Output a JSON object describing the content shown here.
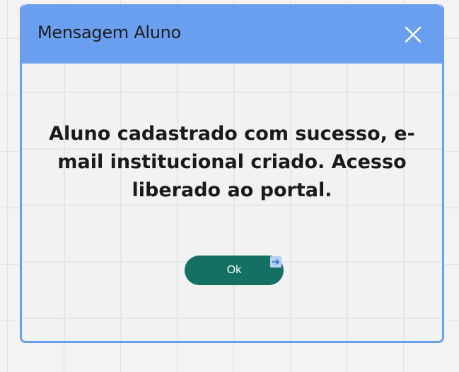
{
  "dialog": {
    "title": "Mensagem Aluno",
    "message": "Aluno cadastrado com sucesso, e-mail institucional criado. Acesso liberado ao portal.",
    "ok_label": "Ok"
  },
  "icons": {
    "close": "close-icon",
    "cursor": "arrow-right-icon"
  },
  "colors": {
    "header": "#6a9ff0",
    "border": "#6a9ff0",
    "ok_button": "#157064",
    "body_background": "#f2f2f2"
  }
}
